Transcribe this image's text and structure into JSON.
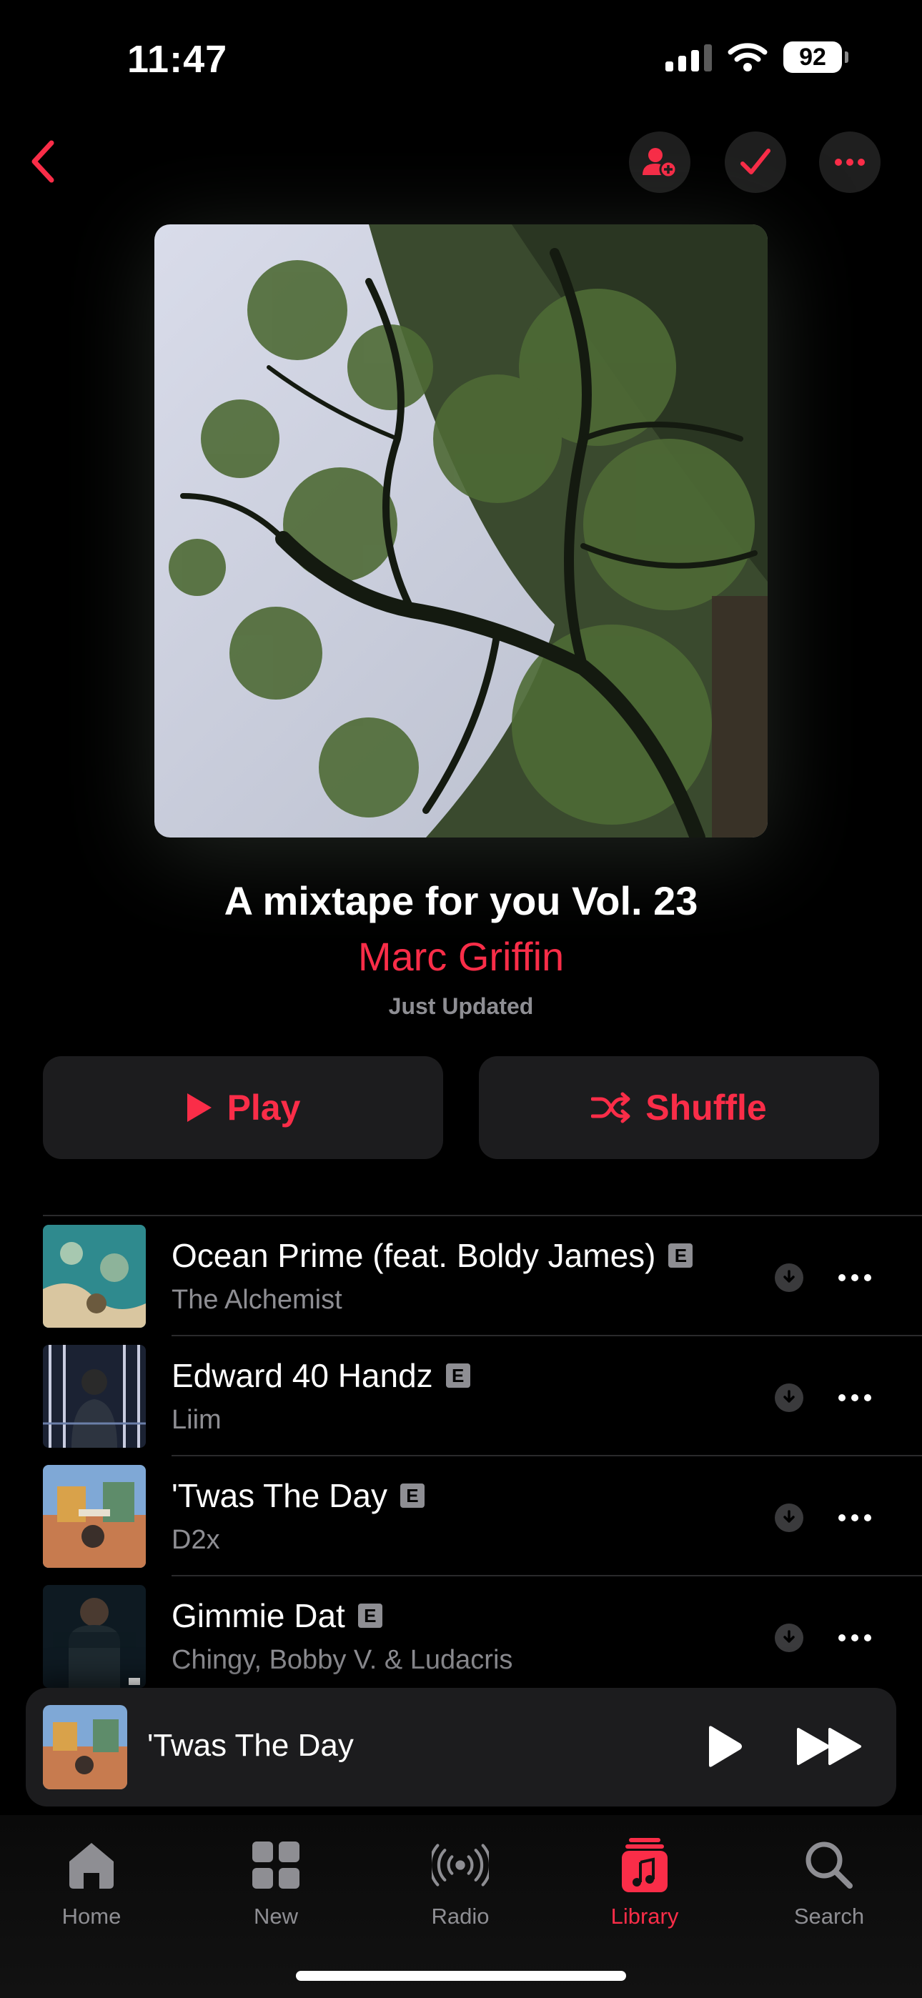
{
  "status": {
    "time": "11:47",
    "battery": "92"
  },
  "playlist": {
    "title": "A mixtape for you Vol. 23",
    "curator": "Marc Griffin",
    "updated": "Just Updated"
  },
  "buttons": {
    "play": "Play",
    "shuffle": "Shuffle"
  },
  "tracks": [
    {
      "title": "Ocean Prime (feat. Boldy James)",
      "artist": "The Alchemist",
      "explicit": "E"
    },
    {
      "title": "Edward 40 Handz",
      "artist": "Liim",
      "explicit": "E"
    },
    {
      "title": "'Twas The Day",
      "artist": "D2x",
      "explicit": "E"
    },
    {
      "title": "Gimmie Dat",
      "artist": "Chingy, Bobby V. & Ludacris",
      "explicit": "E"
    }
  ],
  "now_playing": {
    "title": "'Twas The Day"
  },
  "tabs": [
    {
      "label": "Home",
      "icon": "home-icon"
    },
    {
      "label": "New",
      "icon": "grid-icon"
    },
    {
      "label": "Radio",
      "icon": "radio-icon"
    },
    {
      "label": "Library",
      "icon": "library-icon",
      "active": true
    },
    {
      "label": "Search",
      "icon": "search-icon"
    }
  ],
  "colors": {
    "accent": "#fa2d48",
    "background": "#000000",
    "secondary_text": "#8e8e93"
  }
}
